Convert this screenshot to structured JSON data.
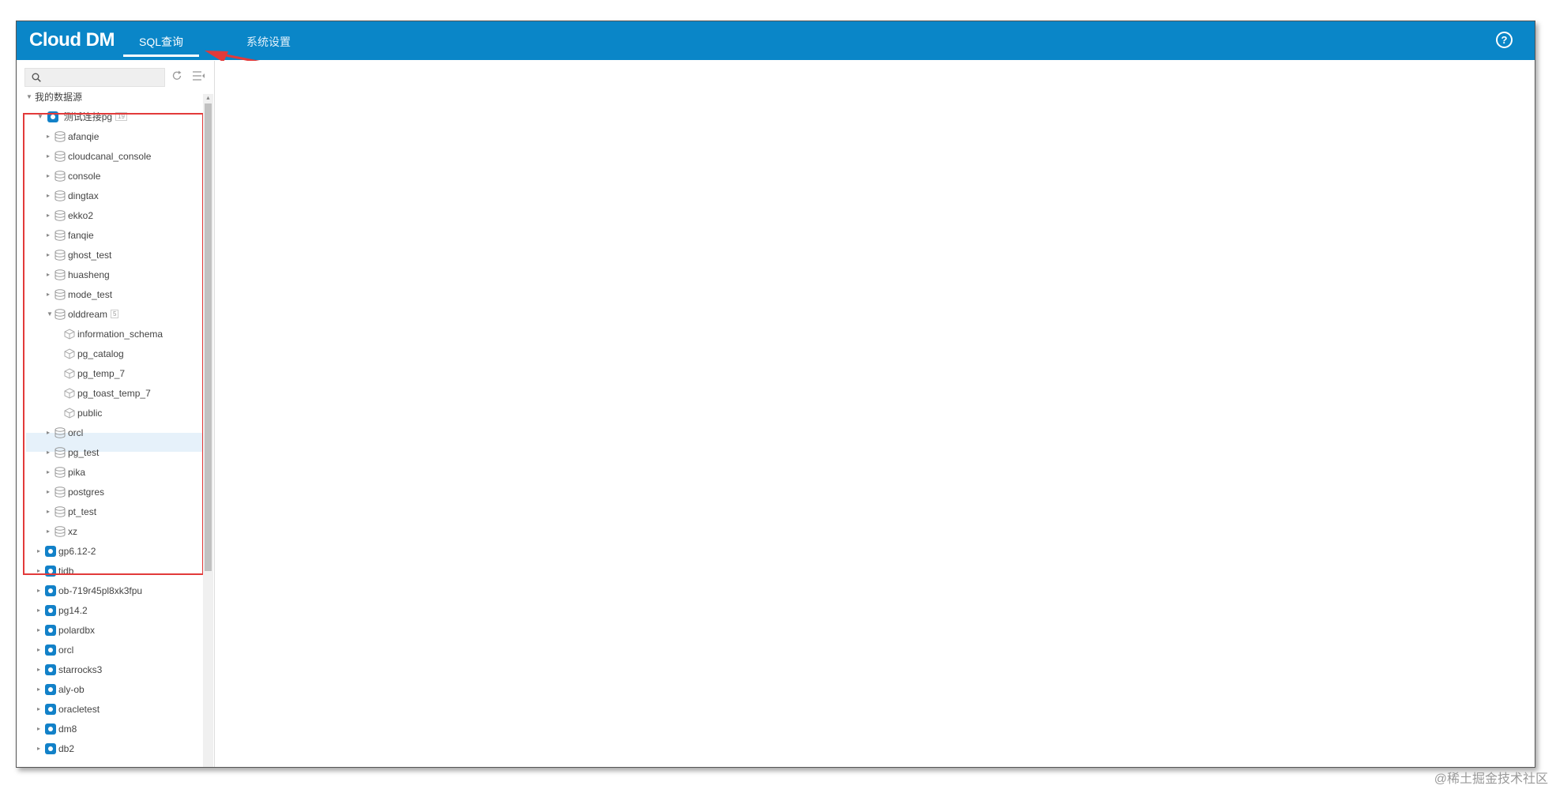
{
  "app": {
    "logo": "Cloud DM"
  },
  "nav": {
    "tabs": [
      {
        "label": "SQL查询",
        "active": true
      },
      {
        "label": "系统设置",
        "active": false
      }
    ]
  },
  "help": {
    "symbol": "?"
  },
  "sidebar": {
    "search": {
      "value": "",
      "placeholder": ""
    },
    "tree": {
      "root": "我的数据源",
      "connection": "测试连接pg",
      "connection_badge": "19",
      "databases": [
        "afanqie",
        "cloudcanal_console",
        "console",
        "dingtax",
        "ekko2",
        "fanqie",
        "ghost_test",
        "huasheng",
        "mode_test",
        "olddream",
        "information_schema",
        "pg_catalog",
        "pg_temp_7",
        "pg_toast_temp_7",
        "public",
        "orcl",
        "pg_test",
        "pika",
        "postgres",
        "pt_test",
        "xz"
      ],
      "olddream_badge": "5",
      "other_connections": [
        "gp6.12-2",
        "tidb",
        "ob-719r45pl8xk3fpu",
        "pg14.2",
        "polardbx",
        "orcl",
        "starrocks3",
        "aly-ob",
        "oracletest",
        "dm8",
        "db2"
      ]
    }
  },
  "watermark": "@稀土掘金技术社区",
  "colors": {
    "header": "#0a86c8",
    "highlight": "#e23a3a",
    "selected": "#e6f1fa"
  }
}
